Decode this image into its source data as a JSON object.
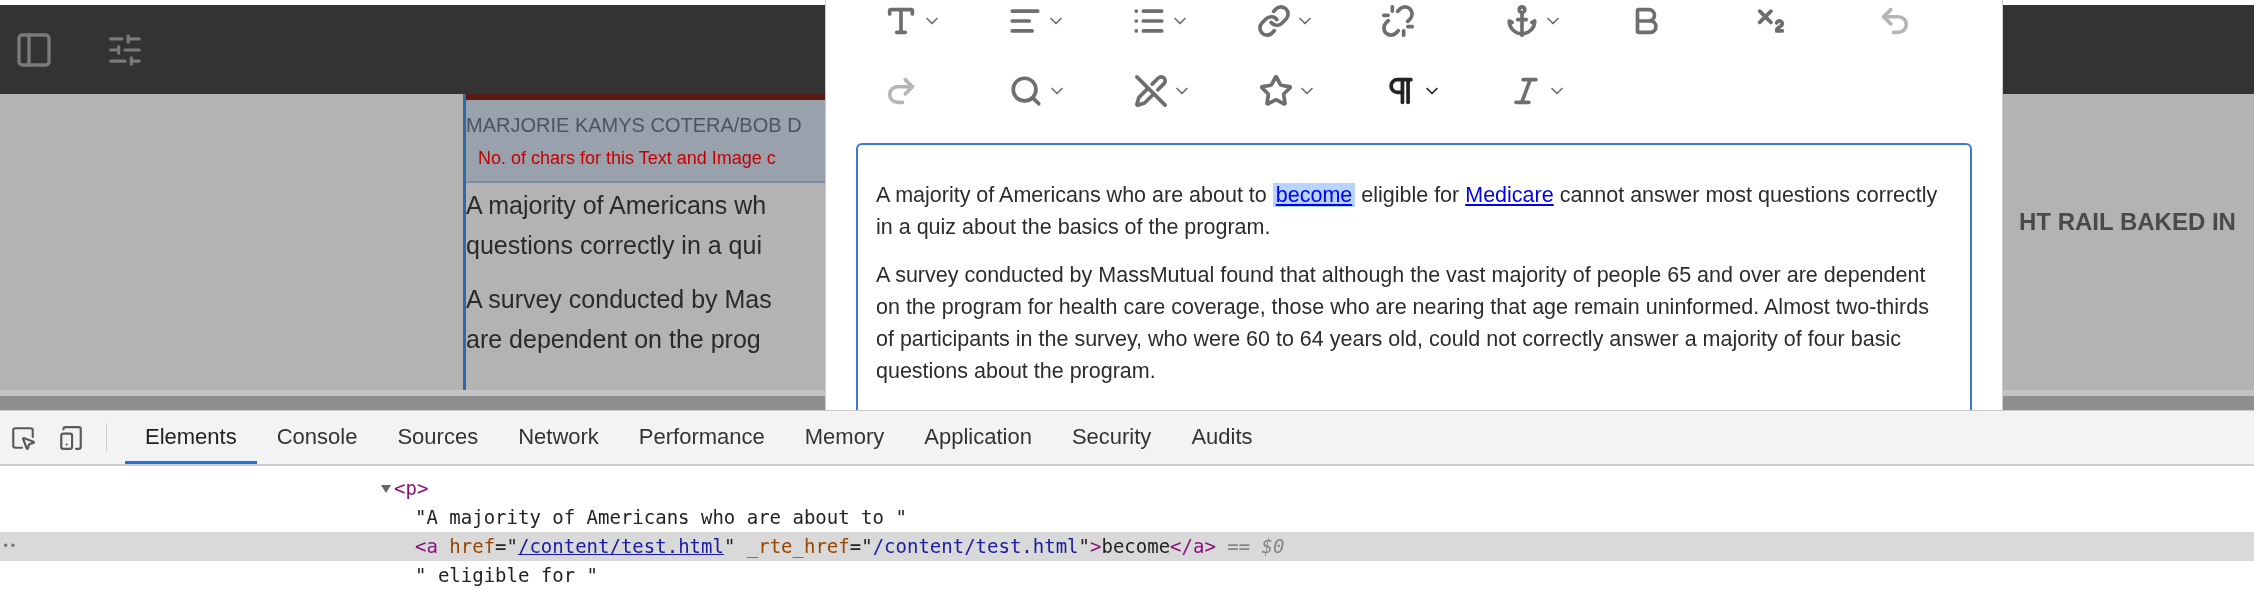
{
  "page": {
    "caption": "MARJORIE KAMYS COTERA/BOB D",
    "char_notice": "No. of chars for this Text and Image c",
    "body_lines": [
      "A majority of Americans wh",
      "questions correctly in a qui",
      "A survey conducted by Mas",
      "are dependent on the prog"
    ],
    "side_heading": "HT RAIL BAKED IN"
  },
  "toolbar": {
    "rows": [
      [
        {
          "menu": true,
          "disabled": false,
          "selected": false
        },
        {
          "menu": true,
          "disabled": false,
          "selected": false
        },
        {
          "menu": true,
          "disabled": false,
          "selected": false
        },
        {
          "menu": true,
          "disabled": false,
          "selected": false
        },
        {
          "menu": false,
          "disabled": false,
          "selected": false
        },
        {
          "menu": true,
          "disabled": false,
          "selected": false
        },
        {
          "menu": false,
          "disabled": false,
          "selected": false
        },
        {
          "menu": false,
          "disabled": false,
          "selected": false
        },
        {
          "menu": false,
          "disabled": true,
          "selected": false
        }
      ],
      [
        {
          "menu": false,
          "disabled": true,
          "selected": false
        },
        {
          "menu": true,
          "disabled": false,
          "selected": false
        },
        {
          "menu": true,
          "disabled": false,
          "selected": false
        },
        {
          "menu": true,
          "disabled": false,
          "selected": false
        },
        {
          "menu": true,
          "disabled": false,
          "selected": true
        },
        {
          "menu": true,
          "disabled": false,
          "selected": false
        }
      ]
    ]
  },
  "editor": {
    "paragraphs": [
      [
        {
          "kind": "text",
          "text": "A majority of Americans who are about to "
        },
        {
          "kind": "link",
          "text": "become",
          "selected": true
        },
        {
          "kind": "text",
          "text": " eligible for "
        },
        {
          "kind": "link",
          "text": "Medicare",
          "selected": false
        },
        {
          "kind": "text",
          "text": " cannot answer most questions correctly in a quiz about the basics of the program."
        }
      ],
      [
        {
          "kind": "text",
          "text": "A survey conducted by MassMutual found that although the vast majority of people 65 and over are dependent on the program for health care coverage, those who are nearing that age remain uninformed. Almost two-thirds of participants in the survey, who were 60 to 64 years old, could not correctly answer a majority of four basic questions about the program."
        }
      ]
    ]
  },
  "devtools": {
    "tabs": [
      {
        "label": "Elements",
        "selected": true
      },
      {
        "label": "Console",
        "selected": false
      },
      {
        "label": "Sources",
        "selected": false
      },
      {
        "label": "Network",
        "selected": false
      },
      {
        "label": "Performance",
        "selected": false
      },
      {
        "label": "Memory",
        "selected": false
      },
      {
        "label": "Application",
        "selected": false
      },
      {
        "label": "Security",
        "selected": false
      },
      {
        "label": "Audits",
        "selected": false
      }
    ],
    "row_marker": "••",
    "tree": {
      "open_tag": "<p>",
      "expanded": true,
      "children": [
        {
          "selected": false,
          "segments": [
            {
              "kind": "text",
              "text": "\"A majority of Americans who are about to \""
            }
          ]
        },
        {
          "selected": true,
          "segments": [
            {
              "kind": "tag",
              "text": "<a"
            },
            {
              "kind": "attr",
              "text": " href"
            },
            {
              "kind": "punct",
              "text": "=\""
            },
            {
              "kind": "link",
              "text": "/content/test.html"
            },
            {
              "kind": "punct",
              "text": "\""
            },
            {
              "kind": "attr",
              "text": " _rte_href"
            },
            {
              "kind": "punct",
              "text": "=\""
            },
            {
              "kind": "value",
              "text": "/content/test.html"
            },
            {
              "kind": "punct",
              "text": "\""
            },
            {
              "kind": "tag",
              "text": ">"
            },
            {
              "kind": "text",
              "text": "become"
            },
            {
              "kind": "tag",
              "text": "</a>"
            },
            {
              "kind": "ref",
              "text": " == $0"
            }
          ]
        },
        {
          "selected": false,
          "segments": [
            {
              "kind": "text",
              "text": "\" eligible for \""
            }
          ]
        }
      ]
    }
  }
}
